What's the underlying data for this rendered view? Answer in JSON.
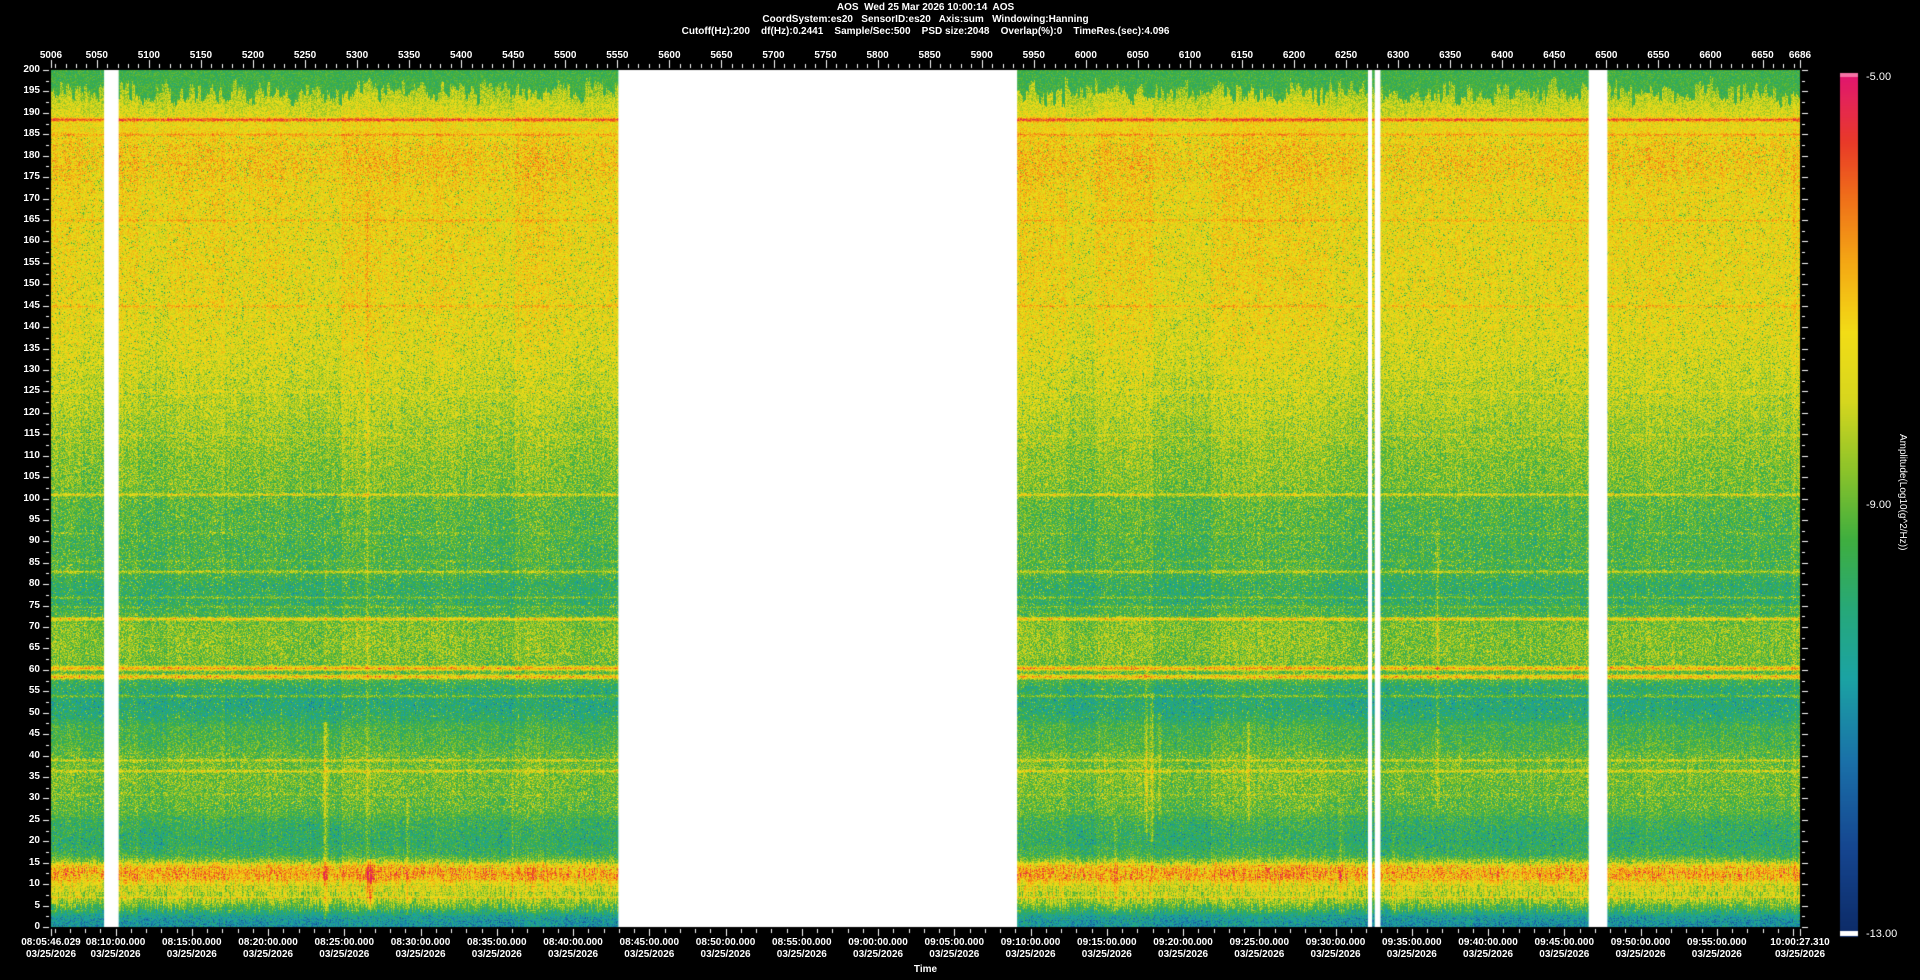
{
  "header": {
    "title": "AOS  Wed 25 Mar 2026 10:00:14  AOS",
    "info_line1": "CoordSystem:es20   SensorID:es20   Axis:sum   Windowing:Hanning",
    "info_line2": "Cutoff(Hz):200    df(Hz):0.2441    Sample/Sec:500    PSD size:2048    Overlap(%):0    TimeRes.(sec):4.096"
  },
  "axes": {
    "time_label": "Time",
    "date_label": "03/25/2026"
  },
  "colorbar": {
    "title": "Amplitude(Log10(g^2/Hz))",
    "max_label": "-5.00",
    "mid_label": "-9.00",
    "min_label": "-13.00"
  },
  "chart_data": {
    "type": "heatmap",
    "title": "AOS  Wed 25 Mar 2026 10:00:14  AOS",
    "x_axis_top": {
      "min": 5006,
      "max": 6686,
      "major_tick_step": 50,
      "minor_tick_step": 10,
      "tick_labels": [
        5006,
        5050,
        5100,
        5150,
        5200,
        5250,
        5300,
        5350,
        5400,
        5450,
        5500,
        5550,
        5600,
        5650,
        5700,
        5750,
        5800,
        5850,
        5900,
        5950,
        6000,
        6050,
        6100,
        6150,
        6200,
        6250,
        6300,
        6350,
        6400,
        6450,
        6500,
        6550,
        6600,
        6650,
        6686
      ]
    },
    "frequency_axis": {
      "min": 0,
      "max": 200,
      "label_step": 5,
      "minor_tick_step": 2.5
    },
    "time_axis": {
      "label": "Time",
      "date": "03/25/2026",
      "start": "08:05:46.029",
      "end": "10:00:27.310",
      "major_tick_seconds": 300,
      "minor_tick_seconds": 60,
      "tick_labels": [
        "08:05:46.029",
        "08:10:00.000",
        "08:15:00.000",
        "08:20:00.000",
        "08:25:00.000",
        "08:30:00.000",
        "08:35:00.000",
        "08:40:00.000",
        "08:45:00.000",
        "08:50:00.000",
        "08:55:00.000",
        "09:00:00.000",
        "09:05:00.000",
        "09:10:00.000",
        "09:15:00.000",
        "09:20:00.000",
        "09:25:00.000",
        "09:30:00.000",
        "09:35:00.000",
        "09:40:00.000",
        "09:45:00.000",
        "09:50:00.000",
        "09:55:00.000",
        "10:00:27.310"
      ]
    },
    "amplitude_scale": {
      "label": "Amplitude(Log10(g^2/Hz))",
      "max": -5.0,
      "mid": -9.0,
      "min": -13.0
    },
    "colormap": [
      {
        "t": 0.0,
        "color": "#0c2a66"
      },
      {
        "t": 0.1,
        "color": "#15458f"
      },
      {
        "t": 0.2,
        "color": "#1a6fa8"
      },
      {
        "t": 0.3,
        "color": "#1ba3a3"
      },
      {
        "t": 0.38,
        "color": "#27a878"
      },
      {
        "t": 0.46,
        "color": "#3fae3f"
      },
      {
        "t": 0.54,
        "color": "#8cc32a"
      },
      {
        "t": 0.62,
        "color": "#d6d61e"
      },
      {
        "t": 0.7,
        "color": "#f2dc16"
      },
      {
        "t": 0.78,
        "color": "#f4a814"
      },
      {
        "t": 0.86,
        "color": "#ef6c1a"
      },
      {
        "t": 0.92,
        "color": "#e93a28"
      },
      {
        "t": 0.97,
        "color": "#e42458"
      },
      {
        "t": 1.0,
        "color": "#e01470"
      }
    ],
    "colorbar_caps": {
      "top": "#f573a5",
      "bottom": "#ffffff"
    },
    "background_profile": [
      [
        0,
        0.3
      ],
      [
        1.5,
        0.31
      ],
      [
        3,
        0.36
      ],
      [
        4.5,
        0.46
      ],
      [
        6,
        0.56
      ],
      [
        8,
        0.6
      ],
      [
        10,
        0.65
      ],
      [
        11.5,
        0.76
      ],
      [
        13,
        0.78
      ],
      [
        14.5,
        0.7
      ],
      [
        15.5,
        0.55
      ],
      [
        17,
        0.45
      ],
      [
        20,
        0.42
      ],
      [
        24,
        0.44
      ],
      [
        27,
        0.48
      ],
      [
        32,
        0.5
      ],
      [
        35,
        0.52
      ],
      [
        38,
        0.51
      ],
      [
        41,
        0.49
      ],
      [
        44,
        0.47
      ],
      [
        47,
        0.46
      ],
      [
        50,
        0.38
      ],
      [
        53,
        0.37
      ],
      [
        56,
        0.4
      ],
      [
        58,
        0.46
      ],
      [
        61,
        0.5
      ],
      [
        64,
        0.53
      ],
      [
        68,
        0.53
      ],
      [
        71,
        0.52
      ],
      [
        73,
        0.46
      ],
      [
        76,
        0.41
      ],
      [
        80,
        0.41
      ],
      [
        83,
        0.46
      ],
      [
        86,
        0.45
      ],
      [
        90,
        0.46
      ],
      [
        95,
        0.47
      ],
      [
        99,
        0.48
      ],
      [
        103,
        0.52
      ],
      [
        107,
        0.53
      ],
      [
        111,
        0.54
      ],
      [
        116,
        0.57
      ],
      [
        121,
        0.6
      ],
      [
        127,
        0.62
      ],
      [
        133,
        0.65
      ],
      [
        140,
        0.67
      ],
      [
        148,
        0.68
      ],
      [
        156,
        0.69
      ],
      [
        163,
        0.69
      ],
      [
        170,
        0.7
      ],
      [
        174,
        0.71
      ],
      [
        178,
        0.73
      ],
      [
        182,
        0.72
      ],
      [
        186,
        0.69
      ],
      [
        189,
        0.65
      ],
      [
        192,
        0.62
      ],
      [
        195,
        0.58
      ],
      [
        198,
        0.54
      ],
      [
        200,
        0.52
      ]
    ],
    "tonal_lines": [
      [
        188.5,
        0.26,
        0.7
      ],
      [
        185,
        0.1,
        0.5
      ],
      [
        165,
        0.07,
        0.5
      ],
      [
        145,
        0.09,
        0.5
      ],
      [
        125,
        0.05,
        0.45
      ],
      [
        115,
        0.04,
        0.45
      ],
      [
        101,
        0.17,
        0.5
      ],
      [
        92,
        0.05,
        0.4
      ],
      [
        85.5,
        0.06,
        0.4
      ],
      [
        83,
        0.15,
        0.5
      ],
      [
        77,
        0.11,
        0.45
      ],
      [
        74.8,
        0.08,
        0.4
      ],
      [
        72,
        0.25,
        0.6
      ],
      [
        60.5,
        0.31,
        0.8
      ],
      [
        58.5,
        0.31,
        0.8
      ],
      [
        54,
        0.15,
        0.5
      ],
      [
        39,
        0.12,
        0.45
      ],
      [
        36.5,
        0.14,
        0.5
      ],
      [
        31,
        0.05,
        0.4
      ],
      [
        7,
        0.1,
        0.45
      ]
    ],
    "data_gaps_x_units": [
      [
        5057,
        5071
      ],
      [
        5551,
        5934
      ],
      [
        6271,
        6275
      ],
      [
        6277.5,
        6283
      ],
      [
        6483,
        6501
      ]
    ],
    "event_streaks": [
      [
        5269,
        2,
        48,
        0.16,
        3
      ],
      [
        5269,
        48,
        92,
        0.06,
        2
      ],
      [
        5310,
        5,
        172,
        0.07,
        2
      ],
      [
        5312,
        4,
        16,
        0.15,
        5
      ],
      [
        5348,
        3,
        30,
        0.1,
        2
      ],
      [
        5449,
        3,
        35,
        0.09,
        2
      ],
      [
        6028,
        3,
        25,
        0.09,
        2
      ],
      [
        6058,
        22,
        60,
        0.12,
        2
      ],
      [
        6064,
        20,
        55,
        0.1,
        2
      ],
      [
        6070,
        25,
        50,
        0.08,
        2
      ],
      [
        6156,
        25,
        48,
        0.1,
        2
      ],
      [
        6244,
        3,
        28,
        0.09,
        2
      ],
      [
        6295,
        3,
        22,
        0.08,
        2
      ],
      [
        6337,
        28,
        95,
        0.1,
        2
      ]
    ]
  }
}
